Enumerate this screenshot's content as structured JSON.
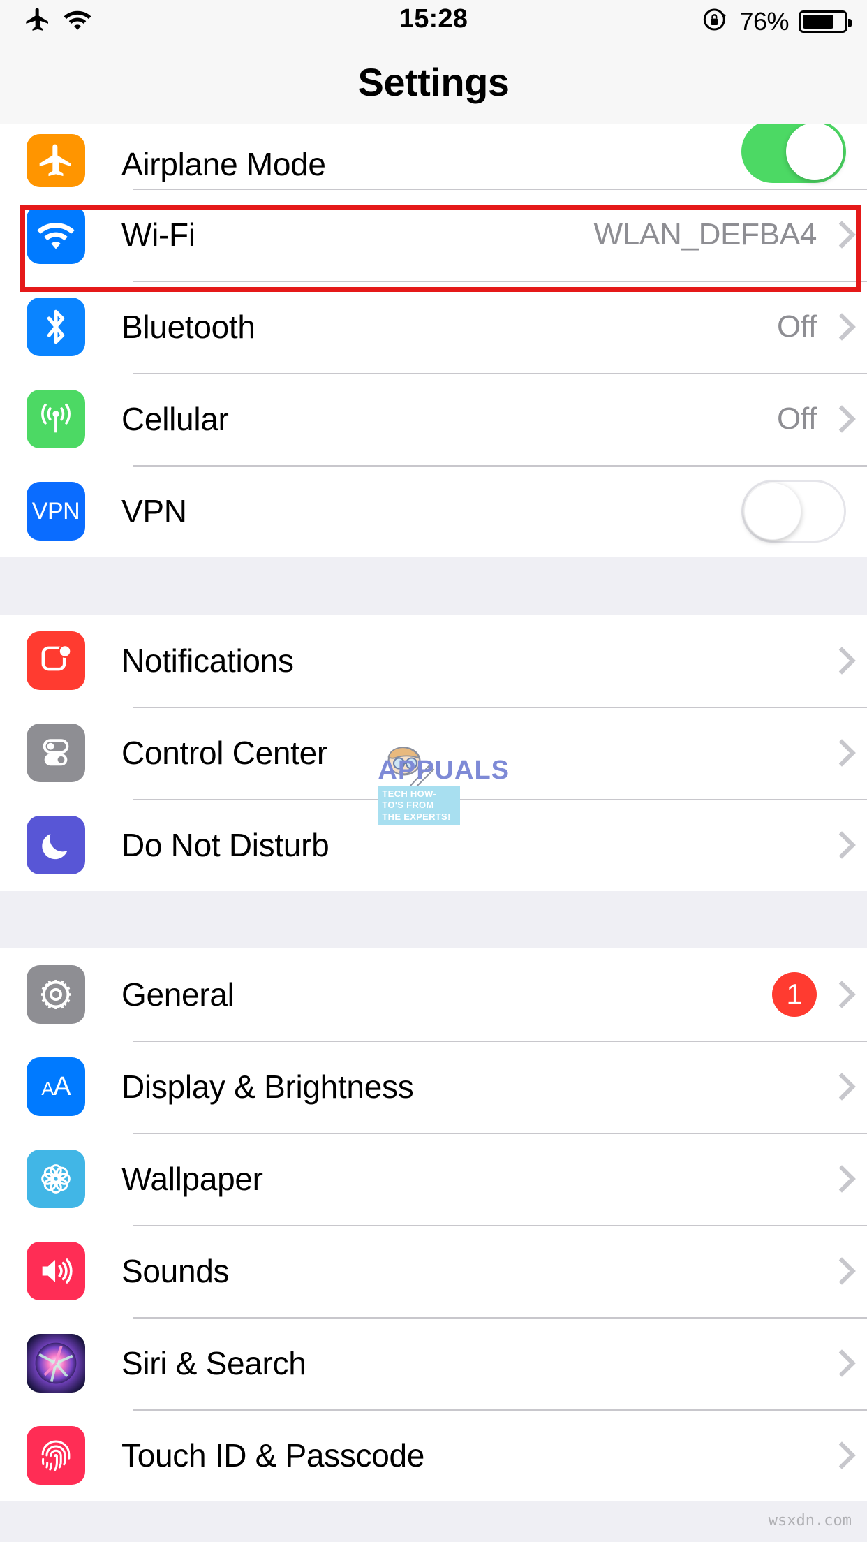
{
  "status_bar": {
    "airplane_icon": "airplane-icon",
    "wifi_icon": "wifi-icon",
    "time": "15:28",
    "rotation_lock_icon": "rotation-lock-icon",
    "battery_percent": "76%",
    "battery_level": 76
  },
  "nav": {
    "title": "Settings"
  },
  "groups": [
    {
      "rows": [
        {
          "icon": "airplane-icon",
          "label": "Airplane Mode",
          "accessory": "toggle",
          "toggle_on": true,
          "partial": true
        },
        {
          "icon": "wifi-icon",
          "label": "Wi-Fi",
          "accessory": "value",
          "value": "WLAN_DEFBA4",
          "highlighted": true
        },
        {
          "icon": "bluetooth-icon",
          "label": "Bluetooth",
          "accessory": "value",
          "value": "Off"
        },
        {
          "icon": "cellular-icon",
          "label": "Cellular",
          "accessory": "value",
          "value": "Off"
        },
        {
          "icon": "vpn-icon",
          "label": "VPN",
          "accessory": "toggle",
          "toggle_on": false,
          "icon_text": "VPN"
        }
      ]
    },
    {
      "rows": [
        {
          "icon": "notifications-icon",
          "label": "Notifications",
          "accessory": "chevron"
        },
        {
          "icon": "control-center-icon",
          "label": "Control Center",
          "accessory": "chevron"
        },
        {
          "icon": "do-not-disturb-icon",
          "label": "Do Not Disturb",
          "accessory": "chevron"
        }
      ]
    },
    {
      "rows": [
        {
          "icon": "general-icon",
          "label": "General",
          "accessory": "badge",
          "badge": "1"
        },
        {
          "icon": "display-brightness-icon",
          "label": "Display & Brightness",
          "accessory": "chevron"
        },
        {
          "icon": "wallpaper-icon",
          "label": "Wallpaper",
          "accessory": "chevron"
        },
        {
          "icon": "sounds-icon",
          "label": "Sounds",
          "accessory": "chevron"
        },
        {
          "icon": "siri-search-icon",
          "label": "Siri & Search",
          "accessory": "chevron"
        },
        {
          "icon": "touch-id-passcode-icon",
          "label": "Touch ID & Passcode",
          "accessory": "chevron"
        }
      ]
    }
  ],
  "annotation": {
    "highlight_color": "#e51919",
    "target_row": "Wi-Fi"
  },
  "watermarks": {
    "appuals_title": "APPUALS",
    "appuals_tagline_line1": "TECH HOW-TO'S FROM",
    "appuals_tagline_line2": "THE EXPERTS!",
    "site": "wsxdn.com"
  },
  "colors": {
    "accent_blue": "#007aff",
    "green_on": "#4cd964",
    "badge_red": "#ff3b30",
    "group_bg": "#efeff4",
    "row_bg": "#ffffff",
    "separator": "#c8c7cc",
    "secondary_text": "#8e8e93"
  }
}
